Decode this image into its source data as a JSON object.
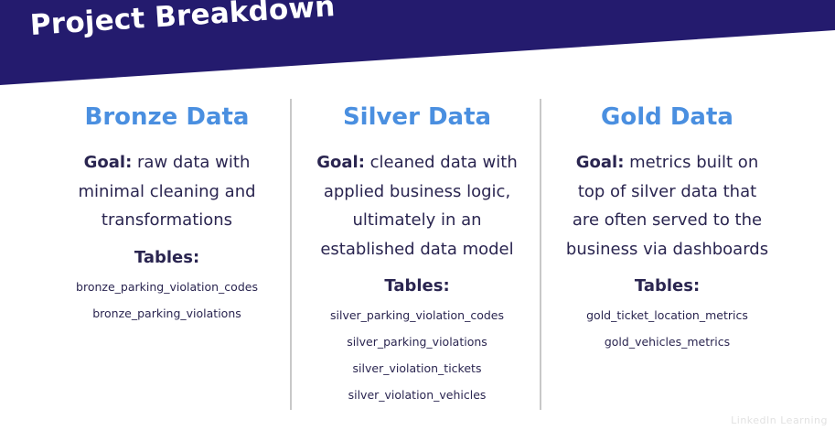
{
  "slide": {
    "title": "Project Breakdown",
    "colors": {
      "banner": "#241b6e",
      "column_title": "#4a8fe0",
      "body_text": "#2a2550",
      "divider": "#c8c8c8"
    },
    "watermark": "LinkedIn Learning"
  },
  "columns": [
    {
      "title": "Bronze Data",
      "goal_label": "Goal:",
      "goal_text": " raw data with minimal cleaning and transformations",
      "tables_label": "Tables:",
      "tables": [
        "bronze_parking_violation_codes",
        "bronze_parking_violations"
      ]
    },
    {
      "title": "Silver Data",
      "goal_label": "Goal:",
      "goal_text": " cleaned data with applied business logic, ultimately in an established data model",
      "tables_label": "Tables:",
      "tables": [
        "silver_parking_violation_codes",
        "silver_parking_violations",
        "silver_violation_tickets",
        "silver_violation_vehicles"
      ]
    },
    {
      "title": "Gold Data",
      "goal_label": "Goal:",
      "goal_text": " metrics built on top of silver data that are often served to the business via dashboards",
      "tables_label": "Tables:",
      "tables": [
        "gold_ticket_location_metrics",
        "gold_vehicles_metrics"
      ]
    }
  ]
}
